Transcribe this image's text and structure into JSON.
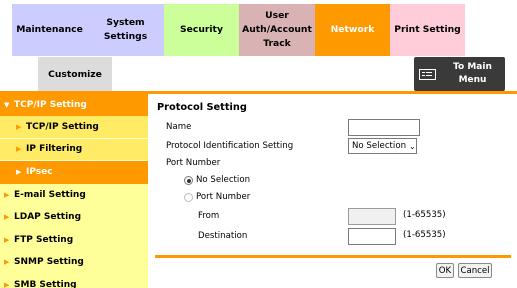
{
  "tabs": [
    {
      "label": "Maintenance"
    },
    {
      "label": "System Settings"
    },
    {
      "label": "Security"
    },
    {
      "label": "User Auth/Account Track"
    },
    {
      "label": "Network"
    },
    {
      "label": "Print Setting"
    }
  ],
  "customize_tab": "Customize",
  "main_menu_button": "To Main Menu",
  "sidebar": {
    "items": [
      {
        "label": "TCP/IP Setting"
      },
      {
        "label": "TCP/IP Setting"
      },
      {
        "label": "IP Filtering"
      },
      {
        "label": "IPsec"
      },
      {
        "label": "E-mail Setting"
      },
      {
        "label": "LDAP Setting"
      },
      {
        "label": "FTP Setting"
      },
      {
        "label": "SNMP Setting"
      },
      {
        "label": "SMB Setting"
      }
    ]
  },
  "form": {
    "title": "Protocol Setting",
    "name_label": "Name",
    "name_value": "",
    "protocol_id_label": "Protocol Identification Setting",
    "protocol_id_value": "No Selection",
    "port_number_label": "Port Number",
    "radio_no_selection": "No Selection",
    "radio_port_number": "Port Number",
    "from_label": "From",
    "from_range": "(1-65535)",
    "destination_label": "Destination",
    "destination_range": "(1-65535)"
  },
  "buttons": {
    "ok": "OK",
    "cancel": "Cancel"
  },
  "colors": {
    "accent": "#ff9900",
    "sidebar_bg": "#ffff99"
  }
}
